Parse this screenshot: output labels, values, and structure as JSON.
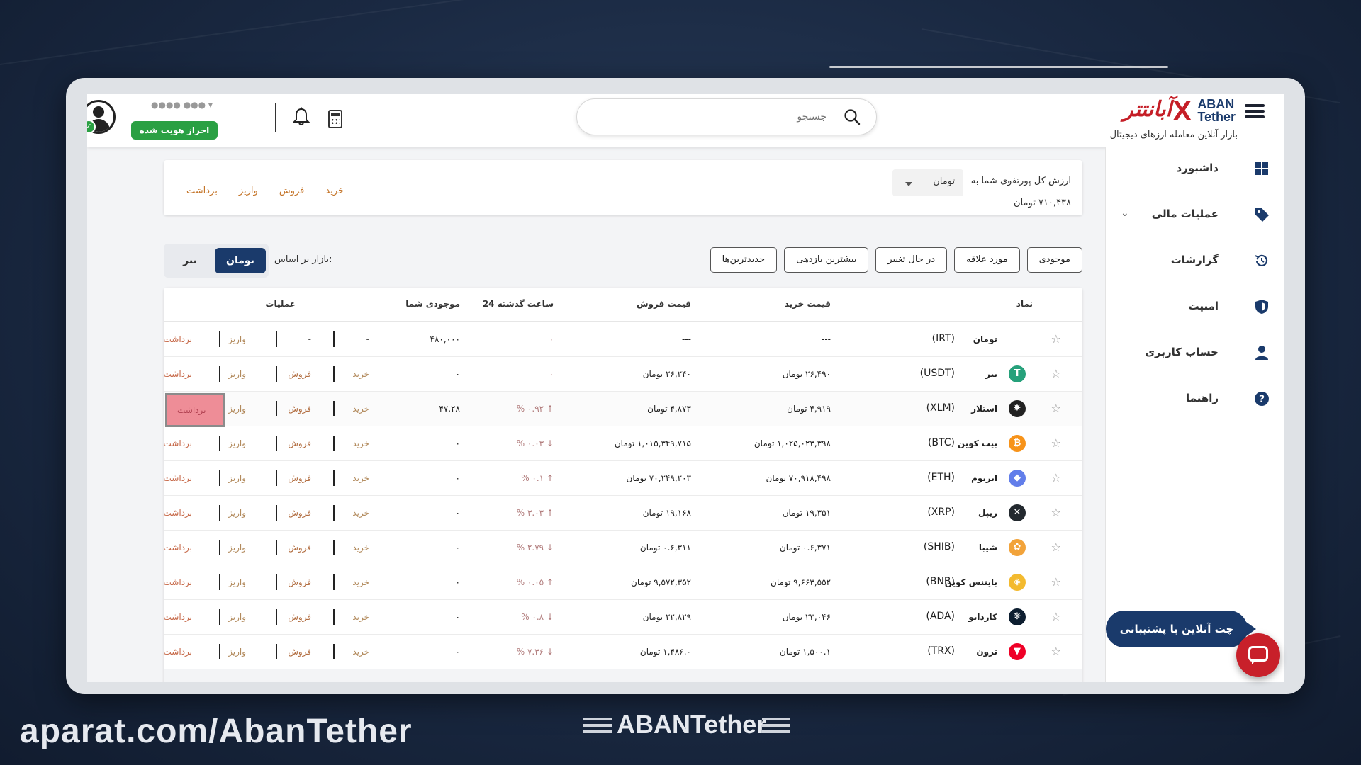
{
  "header": {
    "tagline": "بازار آنلاین معامله ارزهای دیجیتال",
    "logo_fa": "آبانتتر",
    "logo_en_1": "ABAN",
    "logo_en_2": "Tether",
    "search_placeholder": "جستجو",
    "verified_label": "احراز هویت شده",
    "user_name": "●●●● ●●● ▾"
  },
  "sidebar": {
    "items": [
      {
        "label": "داشبورد",
        "icon": "dashboard-icon"
      },
      {
        "label": "عملیات مالی",
        "icon": "tag-icon"
      },
      {
        "label": "گزارشات",
        "icon": "history-icon"
      },
      {
        "label": "امنیت",
        "icon": "shield-icon"
      },
      {
        "label": "حساب کاربری",
        "icon": "user-icon"
      },
      {
        "label": "راهنما",
        "icon": "help-icon"
      }
    ]
  },
  "portfolio": {
    "title": "ارزش کل پورتفوی شما به",
    "currency": "تومان",
    "value": "۷۱۰,۴۳۸ تومان",
    "actions": {
      "buy": "خرید",
      "sell": "فروش",
      "deposit": "واریز",
      "withdraw": "برداشت"
    }
  },
  "filters": {
    "market_label": "بازار بر اساس:",
    "market_rial": "تومان",
    "market_usdt": "تتر",
    "buttons": [
      "موجودی",
      "مورد علاقه",
      "در حال تغییر",
      "بیشترین بازدهی",
      "جدیدترین‌ها"
    ]
  },
  "table": {
    "headers": {
      "symbol": "نماد",
      "buy": "قیمت خرید",
      "sell": "قیمت فروش",
      "change": "24 ساعت گذشته",
      "balance": "موجودی شما",
      "ops": "عملیات"
    },
    "ops": {
      "buy": "خرید",
      "sell": "فروش",
      "deposit": "واریز",
      "withdraw": "برداشت"
    },
    "rows": [
      {
        "name": "تومان",
        "sym": "(IRT)",
        "buy": "---",
        "sell": "---",
        "change": "۰",
        "balance": "۴۸۰,۰۰۰",
        "icon": "irt",
        "color": "#ffffff",
        "glyph": ""
      },
      {
        "name": "تتر",
        "sym": "(USDT)",
        "buy": "۲۶,۴۹۰ تومان",
        "sell": "۲۶,۲۴۰ تومان",
        "change": "۰",
        "balance": "۰",
        "icon": "usdt",
        "color": "#26a17b",
        "glyph": "T"
      },
      {
        "name": "استلار",
        "sym": "(XLM)",
        "buy": "۴,۹۱۹ تومان",
        "sell": "۴,۸۷۳ تومان",
        "change": "↑ ۰.۹۲ %",
        "balance": "۴۷.۲۸",
        "icon": "xlm",
        "color": "#222222",
        "glyph": "✸"
      },
      {
        "name": "بیت کوین",
        "sym": "(BTC)",
        "buy": "۱,۰۲۵,۰۲۳,۳۹۸ تومان",
        "sell": "۱,۰۱۵,۳۴۹,۷۱۵ تومان",
        "change": "↓ ۰.۰۳ %",
        "balance": "۰",
        "icon": "btc",
        "color": "#f7931a",
        "glyph": "₿"
      },
      {
        "name": "اتریوم",
        "sym": "(ETH)",
        "buy": "۷۰,۹۱۸,۴۹۸ تومان",
        "sell": "۷۰,۲۴۹,۲۰۳ تومان",
        "change": "↑ ۰.۱ %",
        "balance": "۰",
        "icon": "eth",
        "color": "#627eea",
        "glyph": "◆"
      },
      {
        "name": "ریپل",
        "sym": "(XRP)",
        "buy": "۱۹,۳۵۱ تومان",
        "sell": "۱۹,۱۶۸ تومان",
        "change": "↑ ۳.۰۳ %",
        "balance": "۰",
        "icon": "xrp",
        "color": "#23292f",
        "glyph": "✕"
      },
      {
        "name": "شیبا",
        "sym": "(SHIB)",
        "buy": "۰.۶,۳۷۱ تومان",
        "sell": "۰.۶,۳۱۱ تومان",
        "change": "↓ ۲.۷۹ %",
        "balance": "۰",
        "icon": "shib",
        "color": "#f2a33a",
        "glyph": "✿"
      },
      {
        "name": "بایننس کوین",
        "sym": "(BNB)",
        "buy": "۹,۶۶۳,۵۵۲ تومان",
        "sell": "۹,۵۷۲,۳۵۲ تومان",
        "change": "↑ ۰.۰۵ %",
        "balance": "۰",
        "icon": "bnb",
        "color": "#f3ba2f",
        "glyph": "◈"
      },
      {
        "name": "کاردانو",
        "sym": "(ADA)",
        "buy": "۲۳,۰۴۶ تومان",
        "sell": "۲۲,۸۲۹ تومان",
        "change": "↓ ۰.۸ %",
        "balance": "۰",
        "icon": "ada",
        "color": "#0d1e30",
        "glyph": "❋"
      },
      {
        "name": "ترون",
        "sym": "(TRX)",
        "buy": "۱,۵۰۰.۱ تومان",
        "sell": "۱,۴۸۶.۰ تومان",
        "change": "↓ ۷.۳۶ %",
        "balance": "۰",
        "icon": "trx",
        "color": "#ef0027",
        "glyph": "▼"
      }
    ]
  },
  "chat": {
    "label": "چت آنلاین با پشتیبانی"
  },
  "watermark": {
    "aparat": "aparat.com/AbanTether",
    "brand": "ABANTether"
  }
}
